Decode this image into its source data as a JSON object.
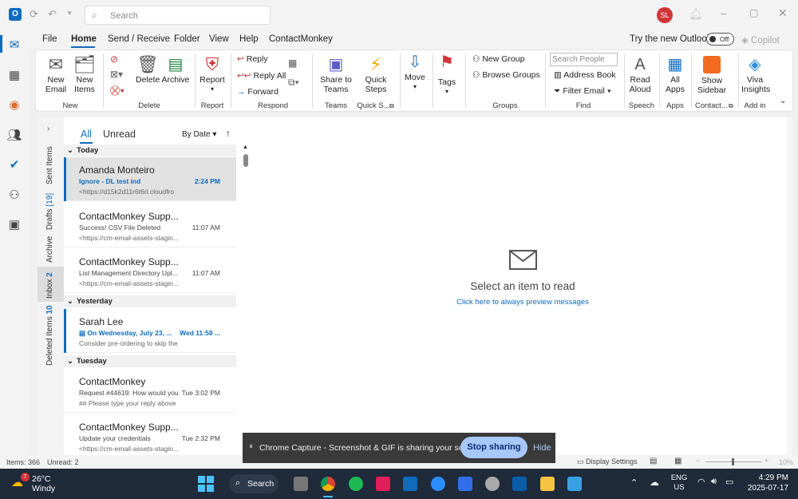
{
  "titlebar": {
    "search_placeholder": "Search",
    "avatar_initials": "SL"
  },
  "menu": {
    "items": [
      "File",
      "Home",
      "Send / Receive",
      "Folder",
      "View",
      "Help",
      "ContactMonkey"
    ],
    "active": "Home",
    "try_new_outlook": "Try the new Outlook",
    "toggle_label": "Off",
    "copilot": "Copilot"
  },
  "ribbon": {
    "new_email": "New\nEmail",
    "new_items": "New\nItems",
    "delete": "Delete",
    "archive": "Archive",
    "report": "Report",
    "reply": "Reply",
    "reply_all": "Reply All",
    "forward": "Forward",
    "share_to_teams": "Share to\nTeams",
    "quick_steps": "Quick\nSteps",
    "move": "Move",
    "tags": "Tags",
    "new_group": "New Group",
    "browse_groups": "Browse Groups",
    "search_people_placeholder": "Search People",
    "address_book": "Address Book",
    "filter_email": "Filter Email",
    "read_aloud": "Read\nAloud",
    "all_apps": "All\nApps",
    "show_sidebar": "Show\nSidebar",
    "viva_insights": "Viva\nInsights",
    "groups": {
      "new": "New",
      "delete": "Delete",
      "report": "Report",
      "respond": "Respond",
      "teams": "Teams",
      "quick_s": "Quick S...",
      "groups": "Groups",
      "find": "Find",
      "speech": "Speech",
      "apps": "Apps",
      "contact": "Contact...",
      "add_in": "Add in"
    }
  },
  "folders": {
    "sent": "Sent Items",
    "drafts": "Drafts",
    "drafts_count": "[19]",
    "archive": "Archive",
    "inbox": "Inbox",
    "inbox_count": "2",
    "deleted": "Deleted Items",
    "deleted_count": "10"
  },
  "list": {
    "tab_all": "All",
    "tab_unread": "Unread",
    "sort": "By Date",
    "today": "Today",
    "yesterday": "Yesterday",
    "tuesday": "Tuesday",
    "messages": [
      {
        "from": "Amanda Monteiro",
        "subject": "Ignore - DL test ind",
        "time": "2:24 PM",
        "preview": "<https://d15k2d11r6t6rl.cloudfro"
      },
      {
        "from": "ContactMonkey Supp...",
        "subject": "Success! CSV File Deleted",
        "time": "11:07 AM",
        "preview": "<https://cm-email-assets-stagin..."
      },
      {
        "from": "ContactMonkey Supp...",
        "subject": "List Management Directory Upl...",
        "time": "11:07 AM",
        "preview": "<https://cm-email-assets-stagin..."
      },
      {
        "from": "Sarah Lee",
        "subject": "On Wednesday, July 23, ...",
        "time": "Wed 11:58 ...",
        "preview": "Consider pre-ordering to skip the"
      },
      {
        "from": "ContactMonkey",
        "subject": "Request #44619: How would you...",
        "time": "Tue 3:02 PM",
        "preview": "##  Please type your reply above"
      },
      {
        "from": "ContactMonkey Supp...",
        "subject": "Update your credentials",
        "time": "Tue 2:32 PM",
        "preview": "<https://cm-email-assets-stagin..."
      }
    ]
  },
  "reading": {
    "empty_title": "Select an item to read",
    "preview_link": "Click here to always preview messages"
  },
  "statusbar": {
    "items": "Items: 366",
    "unread": "Unread: 2",
    "display_settings": "Display Settings",
    "zoom": "10%"
  },
  "share": {
    "message": "Chrome Capture - Screenshot & GIF is sharing your screen.",
    "stop": "Stop sharing",
    "hide": "Hide"
  },
  "taskbar": {
    "weather_temp": "26°C",
    "weather_desc": "Windy",
    "weather_badge": "7",
    "search": "Search",
    "lang1": "ENG",
    "lang2": "US",
    "time": "4:29 PM",
    "date": "2025-07-17"
  },
  "colors": {
    "accent": "#0f6cbd",
    "avatar": "#d13438",
    "selected_row": "#e1e1e1",
    "taskbar": "#1f2a3a"
  }
}
